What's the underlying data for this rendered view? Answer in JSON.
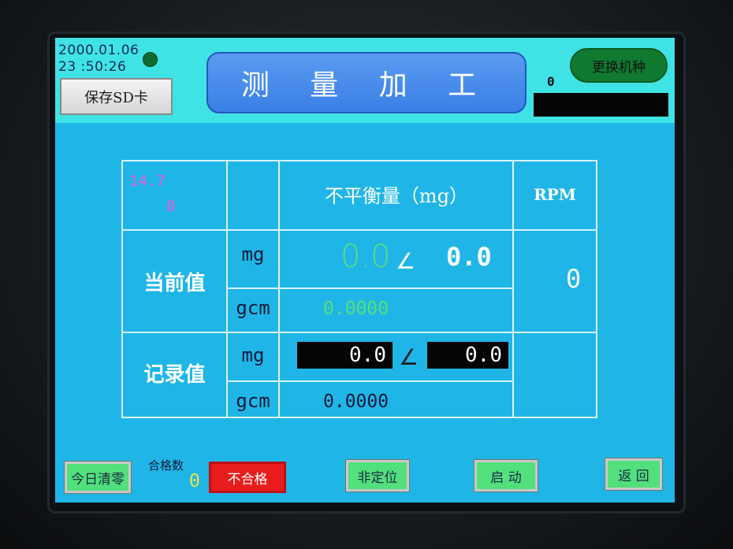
{
  "header": {
    "date": "2000.01.06",
    "time": "23 :50:26",
    "save_sd_label": "保存SD卡",
    "title": "测 量 加 工",
    "change_model_label": "更换机种",
    "top_count": "0"
  },
  "table": {
    "pink_top": "14.7",
    "pink_bottom": "0",
    "header_unbalance": "不平衡量（mg）",
    "header_rpm": "RPM",
    "row_current": "当前值",
    "row_record": "记录值",
    "unit_mg": "mg",
    "unit_gcm": "gcm",
    "current_mg_value": "0.0",
    "current_mg_angle_symbol": "∠",
    "current_mg_angle": "0.0",
    "current_gcm_value": "0.0000",
    "rpm_value": "0",
    "record_mg_value": "0.0",
    "record_mg_angle": "0.0",
    "record_gcm_value": "0.0000"
  },
  "footer": {
    "clear_today_label": "今日清零",
    "pass_count_label": "合格数",
    "pass_count_value": "0",
    "fail_label": "不合格",
    "unposition_label": "非定位",
    "start_label": "启 动",
    "back_label": "返 回"
  },
  "colors": {
    "screen_bg": "#1fb6e7",
    "header_bg": "#3fe3e6",
    "title_bg": "#4a8eea",
    "green_button": "#52e07c",
    "fail_red": "#e81c1c"
  }
}
